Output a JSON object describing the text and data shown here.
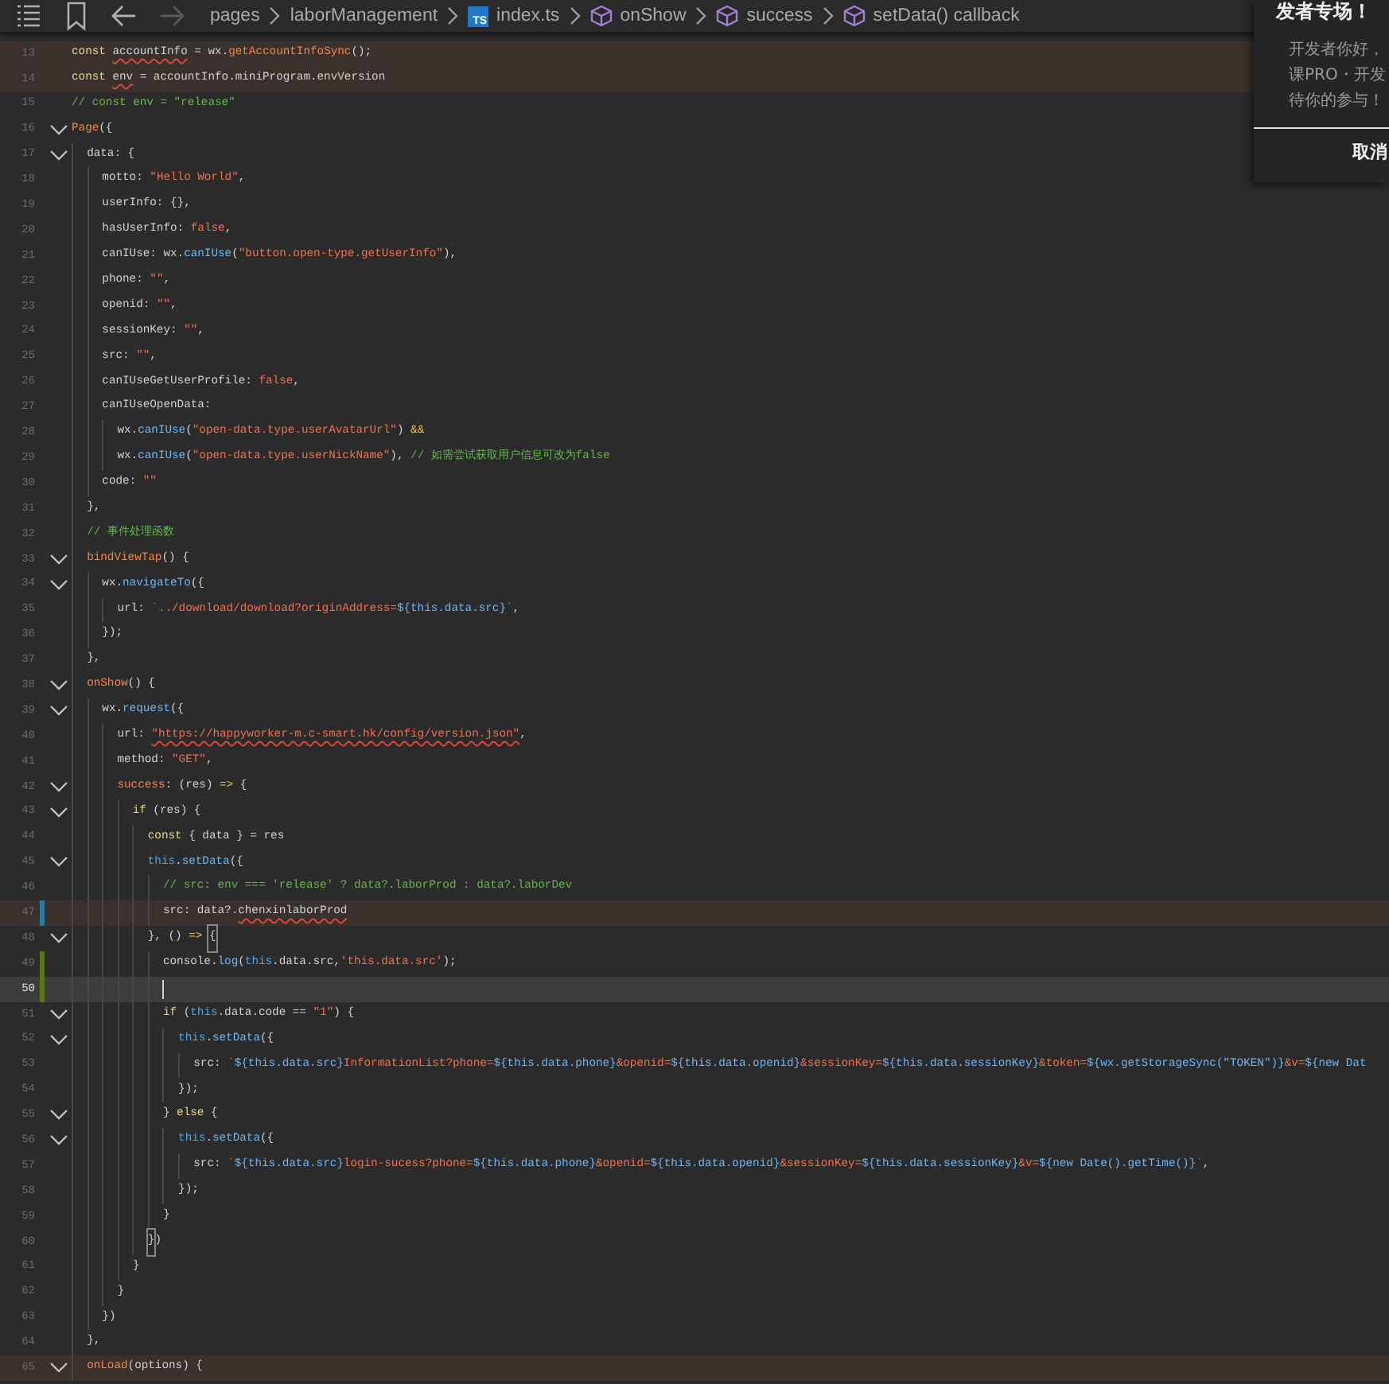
{
  "toolbar": [
    {
      "kind": "menu"
    },
    {
      "kind": "bookmark"
    },
    {
      "kind": "back",
      "disabled": false
    },
    {
      "kind": "forward",
      "disabled": true
    }
  ],
  "breadcrumb": [
    {
      "kind": "folder",
      "label": "pages"
    },
    {
      "kind": "folder",
      "label": "laborManagement"
    },
    {
      "kind": "file",
      "badge": "TS",
      "label": "index.ts"
    },
    {
      "kind": "symbol",
      "label": "onShow"
    },
    {
      "kind": "symbol",
      "label": "success"
    },
    {
      "kind": "symbol",
      "label": "setData() callback"
    }
  ],
  "editor": {
    "lines": [
      {
        "number": "13",
        "flagged": true,
        "tokens": [
          {
            "kind": "keyword",
            "text": "const "
          },
          {
            "kind": "plain",
            "text": "accountInfo",
            "squiggle": true
          },
          {
            "kind": "plain",
            "text": " = wx."
          },
          {
            "kind": "function",
            "text": "getAccountInfoSync"
          },
          {
            "kind": "plain",
            "text": "();"
          }
        ]
      },
      {
        "number": "14",
        "flagged": true,
        "tokens": [
          {
            "kind": "keyword",
            "text": "const "
          },
          {
            "kind": "plain",
            "text": "env",
            "squiggle": true
          },
          {
            "kind": "plain",
            "text": " = accountInfo.miniProgram.envVersion"
          }
        ]
      },
      {
        "number": "15",
        "tokens": [
          {
            "kind": "comment",
            "text": "// const env = \"release\""
          }
        ]
      },
      {
        "number": "16",
        "expanded": true,
        "tokens": [
          {
            "kind": "function",
            "text": "Page"
          },
          {
            "kind": "plain",
            "text": "({"
          }
        ]
      },
      {
        "number": "17",
        "expanded": true,
        "tokens": [
          {
            "kind": "plain",
            "text": "  data: {"
          }
        ]
      },
      {
        "number": "18",
        "tokens": [
          {
            "kind": "plain",
            "text": "    motto: "
          },
          {
            "kind": "string",
            "text": "\"Hello World\""
          },
          {
            "kind": "plain",
            "text": ","
          }
        ]
      },
      {
        "number": "19",
        "tokens": [
          {
            "kind": "plain",
            "text": "    userInfo: {},"
          }
        ]
      },
      {
        "number": "20",
        "tokens": [
          {
            "kind": "plain",
            "text": "    hasUserInfo: "
          },
          {
            "kind": "boolean",
            "text": "false"
          },
          {
            "kind": "plain",
            "text": ","
          }
        ]
      },
      {
        "number": "21",
        "tokens": [
          {
            "kind": "plain",
            "text": "    canIUse: wx."
          },
          {
            "kind": "method",
            "text": "canIUse"
          },
          {
            "kind": "plain",
            "text": "("
          },
          {
            "kind": "string",
            "text": "\"button.open-type.getUserInfo\""
          },
          {
            "kind": "plain",
            "text": "),"
          }
        ]
      },
      {
        "number": "22",
        "tokens": [
          {
            "kind": "plain",
            "text": "    phone: "
          },
          {
            "kind": "string",
            "text": "\"\""
          },
          {
            "kind": "plain",
            "text": ","
          }
        ]
      },
      {
        "number": "23",
        "tokens": [
          {
            "kind": "plain",
            "text": "    openid: "
          },
          {
            "kind": "string",
            "text": "\"\""
          },
          {
            "kind": "plain",
            "text": ","
          }
        ]
      },
      {
        "number": "24",
        "tokens": [
          {
            "kind": "plain",
            "text": "    sessionKey: "
          },
          {
            "kind": "string",
            "text": "\"\""
          },
          {
            "kind": "plain",
            "text": ","
          }
        ]
      },
      {
        "number": "25",
        "tokens": [
          {
            "kind": "plain",
            "text": "    src: "
          },
          {
            "kind": "string",
            "text": "\"\""
          },
          {
            "kind": "plain",
            "text": ","
          }
        ]
      },
      {
        "number": "26",
        "tokens": [
          {
            "kind": "plain",
            "text": "    canIUseGetUserProfile: "
          },
          {
            "kind": "boolean",
            "text": "false"
          },
          {
            "kind": "plain",
            "text": ","
          }
        ]
      },
      {
        "number": "27",
        "tokens": [
          {
            "kind": "plain",
            "text": "    canIUseOpenData:"
          }
        ]
      },
      {
        "number": "28",
        "tokens": [
          {
            "kind": "plain",
            "text": "      wx."
          },
          {
            "kind": "method",
            "text": "canIUse"
          },
          {
            "kind": "plain",
            "text": "("
          },
          {
            "kind": "string",
            "text": "\"open-data.type.userAvatarUrl\""
          },
          {
            "kind": "plain",
            "text": ") "
          },
          {
            "kind": "operator",
            "text": "&&"
          }
        ]
      },
      {
        "number": "29",
        "tokens": [
          {
            "kind": "plain",
            "text": "      wx."
          },
          {
            "kind": "method",
            "text": "canIUse"
          },
          {
            "kind": "plain",
            "text": "("
          },
          {
            "kind": "string",
            "text": "\"open-data.type.userNickName\""
          },
          {
            "kind": "plain",
            "text": "), "
          },
          {
            "kind": "comment",
            "text": "// 如需尝试获取用户信息可改为false"
          }
        ]
      },
      {
        "number": "30",
        "tokens": [
          {
            "kind": "plain",
            "text": "    code: "
          },
          {
            "kind": "string",
            "text": "\"\""
          }
        ]
      },
      {
        "number": "31",
        "tokens": [
          {
            "kind": "plain",
            "text": "  },"
          }
        ]
      },
      {
        "number": "32",
        "tokens": [
          {
            "kind": "comment",
            "text": "  // 事件处理函数"
          }
        ]
      },
      {
        "number": "33",
        "expanded": true,
        "tokens": [
          {
            "kind": "function",
            "text": "  bindViewTap"
          },
          {
            "kind": "plain",
            "text": "() {"
          }
        ]
      },
      {
        "number": "34",
        "expanded": true,
        "tokens": [
          {
            "kind": "plain",
            "text": "    wx."
          },
          {
            "kind": "method",
            "text": "navigateTo"
          },
          {
            "kind": "plain",
            "text": "({"
          }
        ]
      },
      {
        "number": "35",
        "tokens": [
          {
            "kind": "plain",
            "text": "      url: "
          },
          {
            "kind": "string",
            "text": "`../download/download?originAddress="
          },
          {
            "kind": "interp",
            "text": "${this.data.src}"
          },
          {
            "kind": "string",
            "text": "`"
          },
          {
            "kind": "plain",
            "text": ","
          }
        ]
      },
      {
        "number": "36",
        "tokens": [
          {
            "kind": "plain",
            "text": "    });"
          }
        ]
      },
      {
        "number": "37",
        "tokens": [
          {
            "kind": "plain",
            "text": "  },"
          }
        ]
      },
      {
        "number": "38",
        "expanded": true,
        "tokens": [
          {
            "kind": "function",
            "text": "  onShow"
          },
          {
            "kind": "plain",
            "text": "() {"
          }
        ]
      },
      {
        "number": "39",
        "expanded": true,
        "tokens": [
          {
            "kind": "plain",
            "text": "    wx."
          },
          {
            "kind": "method",
            "text": "request"
          },
          {
            "kind": "plain",
            "text": "({"
          }
        ]
      },
      {
        "number": "40",
        "tokens": [
          {
            "kind": "plain",
            "text": "      url: "
          },
          {
            "kind": "string",
            "text": "\"https://happyworker-m.c-smart.hk/config/version.json\"",
            "squiggle": true
          },
          {
            "kind": "plain",
            "text": ","
          }
        ]
      },
      {
        "number": "41",
        "tokens": [
          {
            "kind": "plain",
            "text": "      method: "
          },
          {
            "kind": "string",
            "text": "\"GET\""
          },
          {
            "kind": "plain",
            "text": ","
          }
        ]
      },
      {
        "number": "42",
        "expanded": true,
        "tokens": [
          {
            "kind": "function",
            "text": "      success"
          },
          {
            "kind": "plain",
            "text": ": (res) "
          },
          {
            "kind": "operator",
            "text": "=>"
          },
          {
            "kind": "plain",
            "text": " {"
          }
        ]
      },
      {
        "number": "43",
        "expanded": true,
        "tokens": [
          {
            "kind": "keyword",
            "text": "        if"
          },
          {
            "kind": "plain",
            "text": " (res) {"
          }
        ]
      },
      {
        "number": "44",
        "tokens": [
          {
            "kind": "keyword",
            "text": "          const"
          },
          {
            "kind": "plain",
            "text": " { data } = res"
          }
        ]
      },
      {
        "number": "45",
        "expanded": true,
        "tokens": [
          {
            "kind": "this",
            "text": "          this"
          },
          {
            "kind": "plain",
            "text": "."
          },
          {
            "kind": "method",
            "text": "setData"
          },
          {
            "kind": "plain",
            "text": "({"
          }
        ]
      },
      {
        "number": "46",
        "tokens": [
          {
            "kind": "comment",
            "text": "            // src: env === 'release' ? data?.laborProd : data?.laborDev"
          }
        ]
      },
      {
        "number": "47",
        "flagged": true,
        "modified": true,
        "tokens": [
          {
            "kind": "plain",
            "text": "            src: data?."
          },
          {
            "kind": "plain",
            "text": "chenxinlaborProd",
            "squiggle": true
          }
        ]
      },
      {
        "number": "48",
        "expanded": true,
        "tokens": [
          {
            "kind": "plain",
            "text": "          }, () "
          },
          {
            "kind": "operator",
            "text": "=> "
          },
          {
            "kind": "plain",
            "text": "{",
            "match": true
          }
        ]
      },
      {
        "number": "49",
        "added": true,
        "tokens": [
          {
            "kind": "plain",
            "text": "            console."
          },
          {
            "kind": "method",
            "text": "log"
          },
          {
            "kind": "plain",
            "text": "("
          },
          {
            "kind": "this",
            "text": "this"
          },
          {
            "kind": "plain",
            "text": ".data.src,"
          },
          {
            "kind": "string",
            "text": "'this.data.src'"
          },
          {
            "kind": "plain",
            "text": ");"
          }
        ]
      },
      {
        "number": "50",
        "current": true,
        "added": true,
        "cursor": true
      },
      {
        "number": "51",
        "expanded": true,
        "tokens": [
          {
            "kind": "keyword",
            "text": "            if"
          },
          {
            "kind": "plain",
            "text": " ("
          },
          {
            "kind": "this",
            "text": "this"
          },
          {
            "kind": "plain",
            "text": ".data.code == "
          },
          {
            "kind": "string",
            "text": "\"1\""
          },
          {
            "kind": "plain",
            "text": ") {"
          }
        ]
      },
      {
        "number": "52",
        "expanded": true,
        "tokens": [
          {
            "kind": "this",
            "text": "              this"
          },
          {
            "kind": "plain",
            "text": "."
          },
          {
            "kind": "method",
            "text": "setData"
          },
          {
            "kind": "plain",
            "text": "({"
          }
        ]
      },
      {
        "number": "53",
        "tokens": [
          {
            "kind": "plain",
            "text": "                src: "
          },
          {
            "kind": "string",
            "text": "`"
          },
          {
            "kind": "interp",
            "text": "${this.data.src}"
          },
          {
            "kind": "string",
            "text": "InformationList?phone="
          },
          {
            "kind": "interp",
            "text": "${this.data.phone}"
          },
          {
            "kind": "string",
            "text": "&openid="
          },
          {
            "kind": "interp",
            "text": "${this.data.openid}"
          },
          {
            "kind": "string",
            "text": "&sessionKey="
          },
          {
            "kind": "interp",
            "text": "${this.data.sessionKey}"
          },
          {
            "kind": "string",
            "text": "&token="
          },
          {
            "kind": "interp",
            "text": "${wx.getStorageSync(\"TOKEN\")}"
          },
          {
            "kind": "string",
            "text": "&v="
          },
          {
            "kind": "interp",
            "text": "${new Dat"
          }
        ]
      },
      {
        "number": "54",
        "tokens": [
          {
            "kind": "plain",
            "text": "              });"
          }
        ]
      },
      {
        "number": "55",
        "expanded": true,
        "tokens": [
          {
            "kind": "plain",
            "text": "            } "
          },
          {
            "kind": "keyword",
            "text": "else"
          },
          {
            "kind": "plain",
            "text": " {"
          }
        ]
      },
      {
        "number": "56",
        "expanded": true,
        "tokens": [
          {
            "kind": "this",
            "text": "              this"
          },
          {
            "kind": "plain",
            "text": "."
          },
          {
            "kind": "method",
            "text": "setData"
          },
          {
            "kind": "plain",
            "text": "({"
          }
        ]
      },
      {
        "number": "57",
        "tokens": [
          {
            "kind": "plain",
            "text": "                src: "
          },
          {
            "kind": "string",
            "text": "`"
          },
          {
            "kind": "interp",
            "text": "${this.data.src}"
          },
          {
            "kind": "string",
            "text": "login-sucess?phone="
          },
          {
            "kind": "interp",
            "text": "${this.data.phone}"
          },
          {
            "kind": "string",
            "text": "&openid="
          },
          {
            "kind": "interp",
            "text": "${this.data.openid}"
          },
          {
            "kind": "string",
            "text": "&sessionKey="
          },
          {
            "kind": "interp",
            "text": "${this.data.sessionKey}"
          },
          {
            "kind": "string",
            "text": "&v="
          },
          {
            "kind": "interp",
            "text": "${new Date().getTime()}"
          },
          {
            "kind": "string",
            "text": "`"
          },
          {
            "kind": "plain",
            "text": ","
          }
        ]
      },
      {
        "number": "58",
        "tokens": [
          {
            "kind": "plain",
            "text": "              });"
          }
        ]
      },
      {
        "number": "59",
        "tokens": [
          {
            "kind": "plain",
            "text": "            }"
          }
        ]
      },
      {
        "number": "60",
        "tokens": [
          {
            "kind": "plain",
            "text": "          }",
            "match": true
          },
          {
            "kind": "plain",
            "text": ")"
          }
        ]
      },
      {
        "number": "61",
        "tokens": [
          {
            "kind": "plain",
            "text": "        }"
          }
        ]
      },
      {
        "number": "62",
        "tokens": [
          {
            "kind": "plain",
            "text": "      }"
          }
        ]
      },
      {
        "number": "63",
        "tokens": [
          {
            "kind": "plain",
            "text": "    })"
          }
        ]
      },
      {
        "number": "64",
        "tokens": [
          {
            "kind": "plain",
            "text": "  },"
          }
        ]
      },
      {
        "number": "65",
        "expanded": true,
        "flagged": true,
        "tokens": [
          {
            "kind": "function",
            "text": "  onLoad"
          },
          {
            "kind": "plain",
            "text": "(options) {"
          }
        ]
      }
    ]
  },
  "notification": {
    "title": "发者专场！",
    "body": [
      "开发者你好，",
      "课PRO・开发",
      "待你的参与！"
    ],
    "buttons": [
      "取消"
    ]
  }
}
